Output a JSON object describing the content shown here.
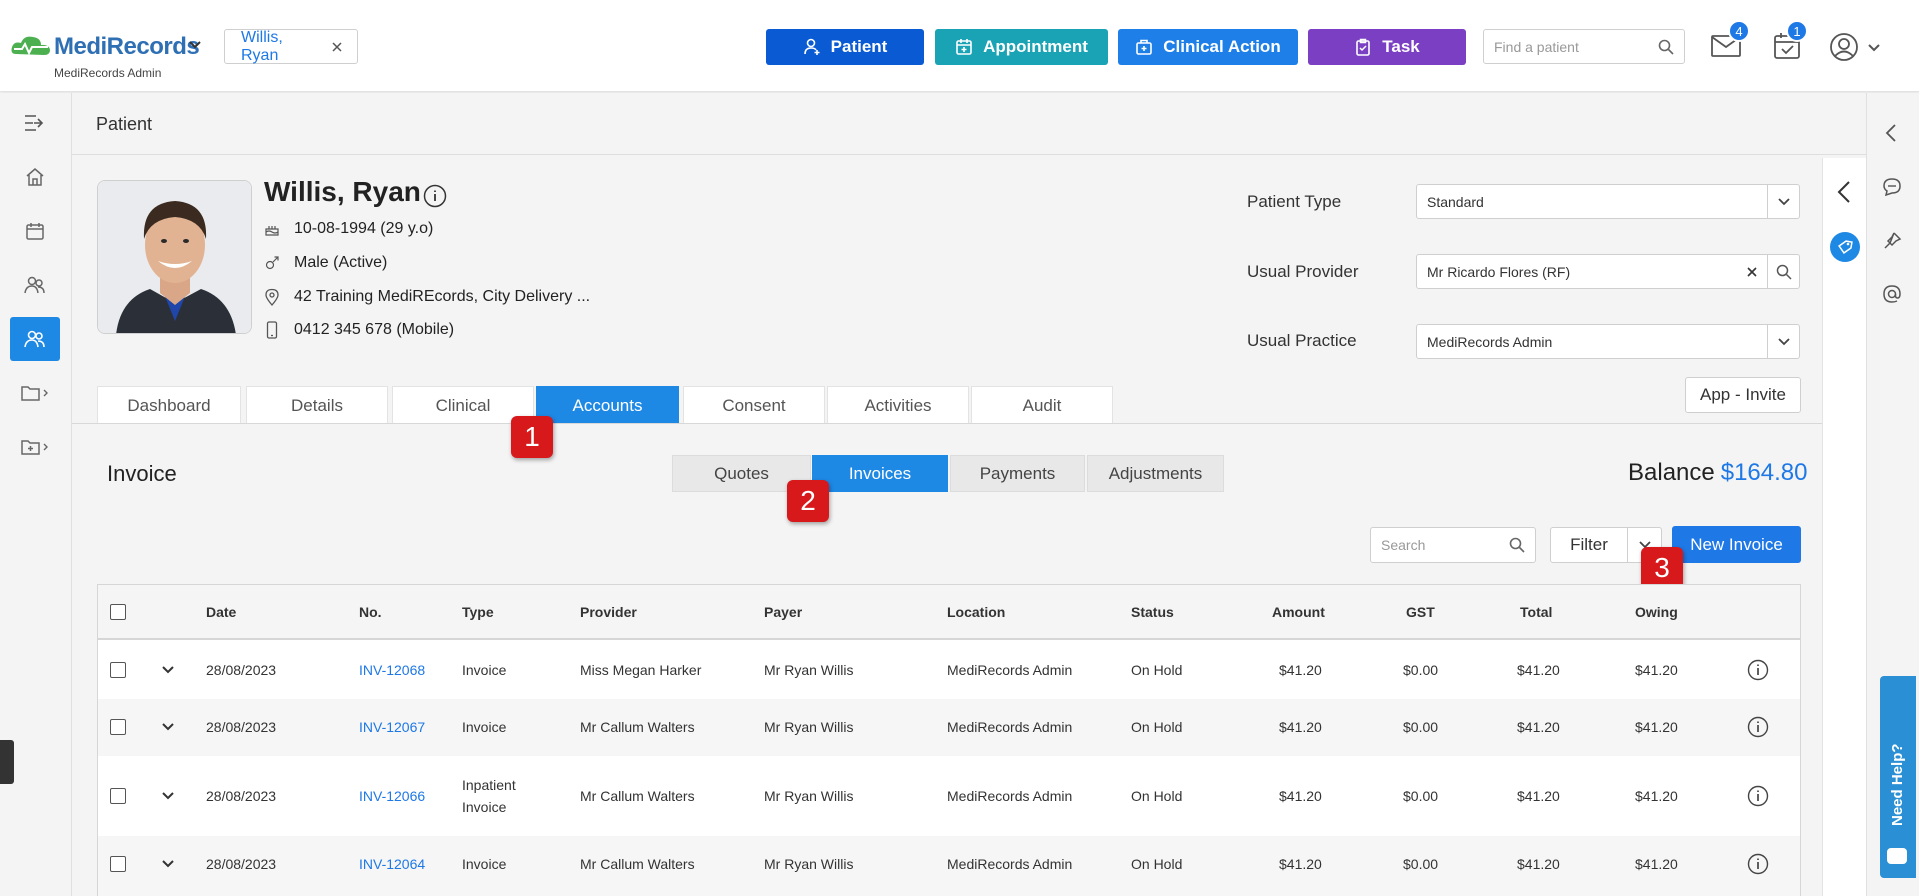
{
  "topbar": {
    "logo": "MediRecords",
    "logo_sub": "MediRecords Admin",
    "patient_chip": "Willis, Ryan",
    "buttons": {
      "patient": "Patient",
      "appointment": "Appointment",
      "clinical_action": "Clinical Action",
      "task": "Task"
    },
    "search_placeholder": "Find a patient",
    "mail_count": "4",
    "tasks_count": "1",
    "colors": {
      "patient": "#0a5bd3",
      "appointment": "#1aa3b4",
      "clinical_action": "#1e7fe8",
      "task": "#7b3fc4"
    }
  },
  "page": {
    "title": "Patient"
  },
  "patient": {
    "name": "Willis, Ryan",
    "dob": "10-08-1994 (29 y.o)",
    "gender": "Male (Active)",
    "address": "42 Training MediREcords, City Delivery ...",
    "phone": "0412 345 678 (Mobile)"
  },
  "fields": {
    "patient_type_label": "Patient Type",
    "patient_type_value": "Standard",
    "usual_provider_label": "Usual Provider",
    "usual_provider_value": "Mr Ricardo Flores (RF)",
    "usual_practice_label": "Usual Practice",
    "usual_practice_value": "MediRecords Admin",
    "app_invite": "App - Invite"
  },
  "tabs": [
    "Dashboard",
    "Details",
    "Clinical",
    "Accounts",
    "Consent",
    "Activities",
    "Audit"
  ],
  "invoice": {
    "heading": "Invoice",
    "segments": [
      "Quotes",
      "Invoices",
      "Payments",
      "Adjustments"
    ],
    "balance_label": "Balance",
    "balance_value": "$164.80",
    "search_placeholder": "Search",
    "filter_label": "Filter",
    "new_invoice": "New Invoice"
  },
  "markers": [
    "1",
    "2",
    "3"
  ],
  "table": {
    "headers": [
      "Date",
      "No.",
      "Type",
      "Provider",
      "Payer",
      "Location",
      "Status",
      "Amount",
      "GST",
      "Total",
      "Owing"
    ],
    "rows": [
      {
        "date": "28/08/2023",
        "no": "INV-12068",
        "type": "Invoice",
        "type2": "",
        "provider": "Miss Megan Harker",
        "payer": "Mr Ryan Willis",
        "location": "MediRecords Admin",
        "status": "On Hold",
        "amount": "$41.20",
        "gst": "$0.00",
        "total": "$41.20",
        "owing": "$41.20"
      },
      {
        "date": "28/08/2023",
        "no": "INV-12067",
        "type": "Invoice",
        "type2": "",
        "provider": "Mr Callum Walters",
        "payer": "Mr Ryan Willis",
        "location": "MediRecords Admin",
        "status": "On Hold",
        "amount": "$41.20",
        "gst": "$0.00",
        "total": "$41.20",
        "owing": "$41.20"
      },
      {
        "date": "28/08/2023",
        "no": "INV-12066",
        "type": "Inpatient",
        "type2": "Invoice",
        "provider": "Mr Callum Walters",
        "payer": "Mr Ryan Willis",
        "location": "MediRecords Admin",
        "status": "On Hold",
        "amount": "$41.20",
        "gst": "$0.00",
        "total": "$41.20",
        "owing": "$41.20"
      },
      {
        "date": "28/08/2023",
        "no": "INV-12064",
        "type": "Invoice",
        "type2": "",
        "provider": "Mr Callum Walters",
        "payer": "Mr Ryan Willis",
        "location": "MediRecords Admin",
        "status": "On Hold",
        "amount": "$41.20",
        "gst": "$0.00",
        "total": "$41.20",
        "owing": "$41.20"
      }
    ]
  },
  "help": {
    "label": "Need Help?"
  }
}
